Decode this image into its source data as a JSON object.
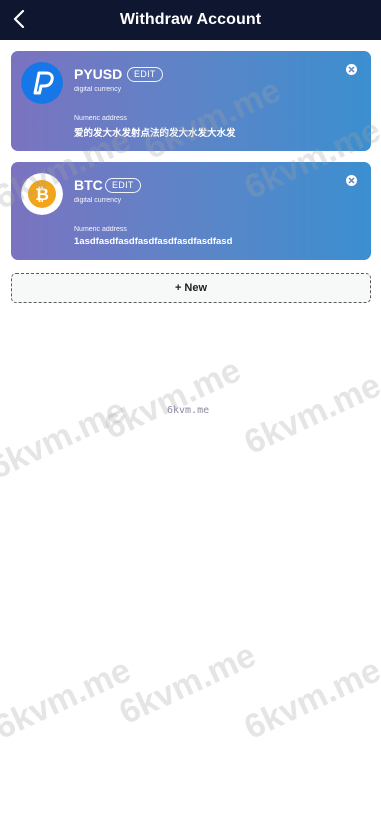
{
  "header": {
    "title": "Withdraw Account",
    "back_icon": "chevron-left-icon"
  },
  "accounts": [
    {
      "coin": "PYUSD",
      "edit_label": "EDIT",
      "type_label": "digital currency",
      "address_label": "Numeric address",
      "address": "爱的发大水发射点法的发大水发大水发",
      "logo_icon": "paypal-logo-icon",
      "logo_color": "#1577e8"
    },
    {
      "coin": "BTC",
      "edit_label": "EDIT",
      "type_label": "digital currency",
      "address_label": "Numeric address",
      "address": "1asdfasdfasdfasdfasdfasdfasdfasd",
      "logo_icon": "bitcoin-logo-icon",
      "logo_color": "#f2a51a"
    }
  ],
  "new_button": {
    "label": "+ New"
  },
  "watermark": {
    "text": "6kvm.me",
    "small_text": "6kvm.me"
  },
  "colors": {
    "header_bg": "#0f1630",
    "card_gradient_start": "#7b73c0",
    "card_gradient_end": "#3b8fd0"
  }
}
